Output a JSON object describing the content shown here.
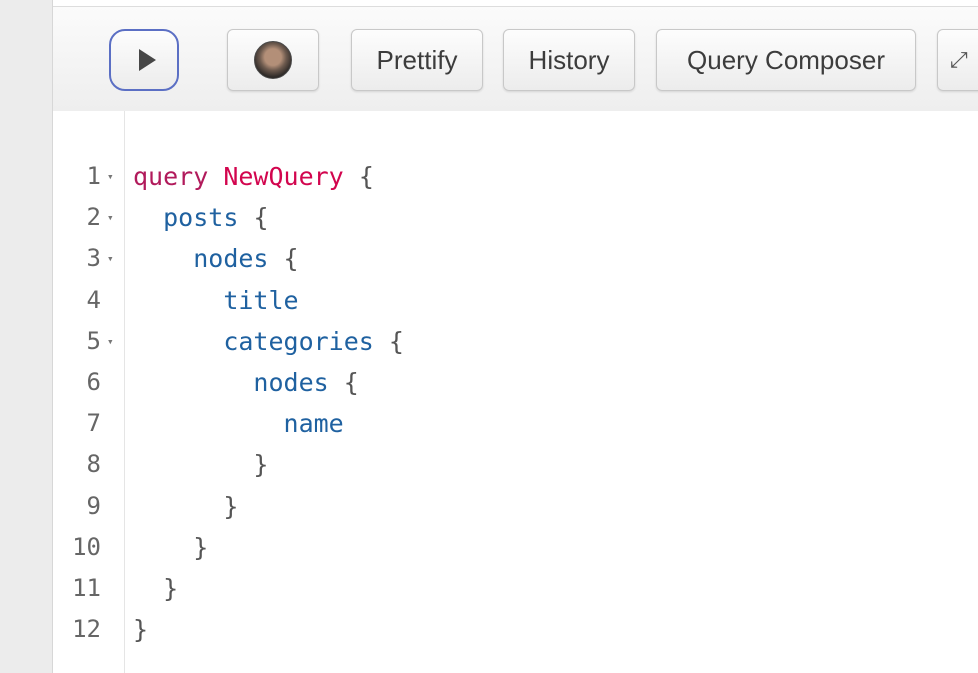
{
  "toolbar": {
    "run_icon": "play-icon",
    "avatar_icon": "user-avatar",
    "prettify_label": "Prettify",
    "history_label": "History",
    "composer_label": "Query Composer",
    "fullscreen_icon": "expand-icon"
  },
  "editor": {
    "lines": [
      {
        "number": "1",
        "fold": true,
        "indent": 0,
        "keyword": "query",
        "name": "NewQuery",
        "field": "",
        "punct": "{"
      },
      {
        "number": "2",
        "fold": true,
        "indent": 1,
        "keyword": "",
        "name": "",
        "field": "posts",
        "punct": "{"
      },
      {
        "number": "3",
        "fold": true,
        "indent": 2,
        "keyword": "",
        "name": "",
        "field": "nodes",
        "punct": "{"
      },
      {
        "number": "4",
        "fold": false,
        "indent": 3,
        "keyword": "",
        "name": "",
        "field": "title",
        "punct": ""
      },
      {
        "number": "5",
        "fold": true,
        "indent": 3,
        "keyword": "",
        "name": "",
        "field": "categories",
        "punct": "{"
      },
      {
        "number": "6",
        "fold": false,
        "indent": 4,
        "keyword": "",
        "name": "",
        "field": "nodes",
        "punct": "{"
      },
      {
        "number": "7",
        "fold": false,
        "indent": 5,
        "keyword": "",
        "name": "",
        "field": "name",
        "punct": ""
      },
      {
        "number": "8",
        "fold": false,
        "indent": 4,
        "keyword": "",
        "name": "",
        "field": "",
        "punct": "}"
      },
      {
        "number": "9",
        "fold": false,
        "indent": 3,
        "keyword": "",
        "name": "",
        "field": "",
        "punct": "}"
      },
      {
        "number": "10",
        "fold": false,
        "indent": 2,
        "keyword": "",
        "name": "",
        "field": "",
        "punct": "}"
      },
      {
        "number": "11",
        "fold": false,
        "indent": 1,
        "keyword": "",
        "name": "",
        "field": "",
        "punct": "}"
      },
      {
        "number": "12",
        "fold": false,
        "indent": 0,
        "keyword": "",
        "name": "",
        "field": "",
        "punct": "}"
      }
    ]
  },
  "colors": {
    "keyword": "#b11a5b",
    "definition": "#d2054e",
    "field": "#1f61a0",
    "run_button_border": "#5b6fc4"
  }
}
